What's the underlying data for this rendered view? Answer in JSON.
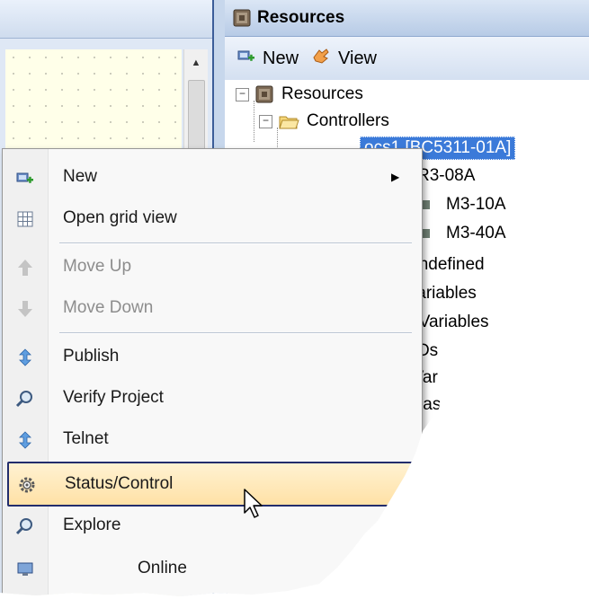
{
  "resources_panel": {
    "title": "Resources",
    "toolbar": {
      "new_label": "New",
      "view_label": "View"
    },
    "tree": {
      "root": "Resources",
      "controllers": "Controllers",
      "selected_item": "ocs1 [BC5311-01A]",
      "visible_fragments": [
        "R3-08A",
        "M3-10A",
        "M3-40A",
        "Undefined",
        "Variables",
        "NVariables",
        "PIDs",
        "XVar",
        "Unas"
      ]
    }
  },
  "context_menu": {
    "items": [
      {
        "label": "New",
        "icon": "new-icon",
        "submenu": true
      },
      {
        "label": "Open grid view",
        "icon": "grid-icon"
      },
      {
        "label": "Move Up",
        "icon": "arrow-up-icon",
        "disabled": true
      },
      {
        "label": "Move Down",
        "icon": "arrow-down-icon",
        "disabled": true
      },
      {
        "label": "Publish",
        "icon": "publish-icon"
      },
      {
        "label": "Verify Project",
        "icon": "verify-icon"
      },
      {
        "label": "Telnet",
        "icon": "telnet-icon"
      },
      {
        "label": "Status/Control",
        "icon": "gear-icon",
        "highlighted": true
      },
      {
        "label": "Explore",
        "icon": "explore-icon"
      },
      {
        "label": "Online",
        "icon": "online-icon"
      }
    ]
  },
  "colors": {
    "selection": "#3b7ad9",
    "menu_highlight": "#ffe1a6",
    "menu_highlight_border": "#222d6c",
    "panel_header": "#b7cbe6"
  }
}
